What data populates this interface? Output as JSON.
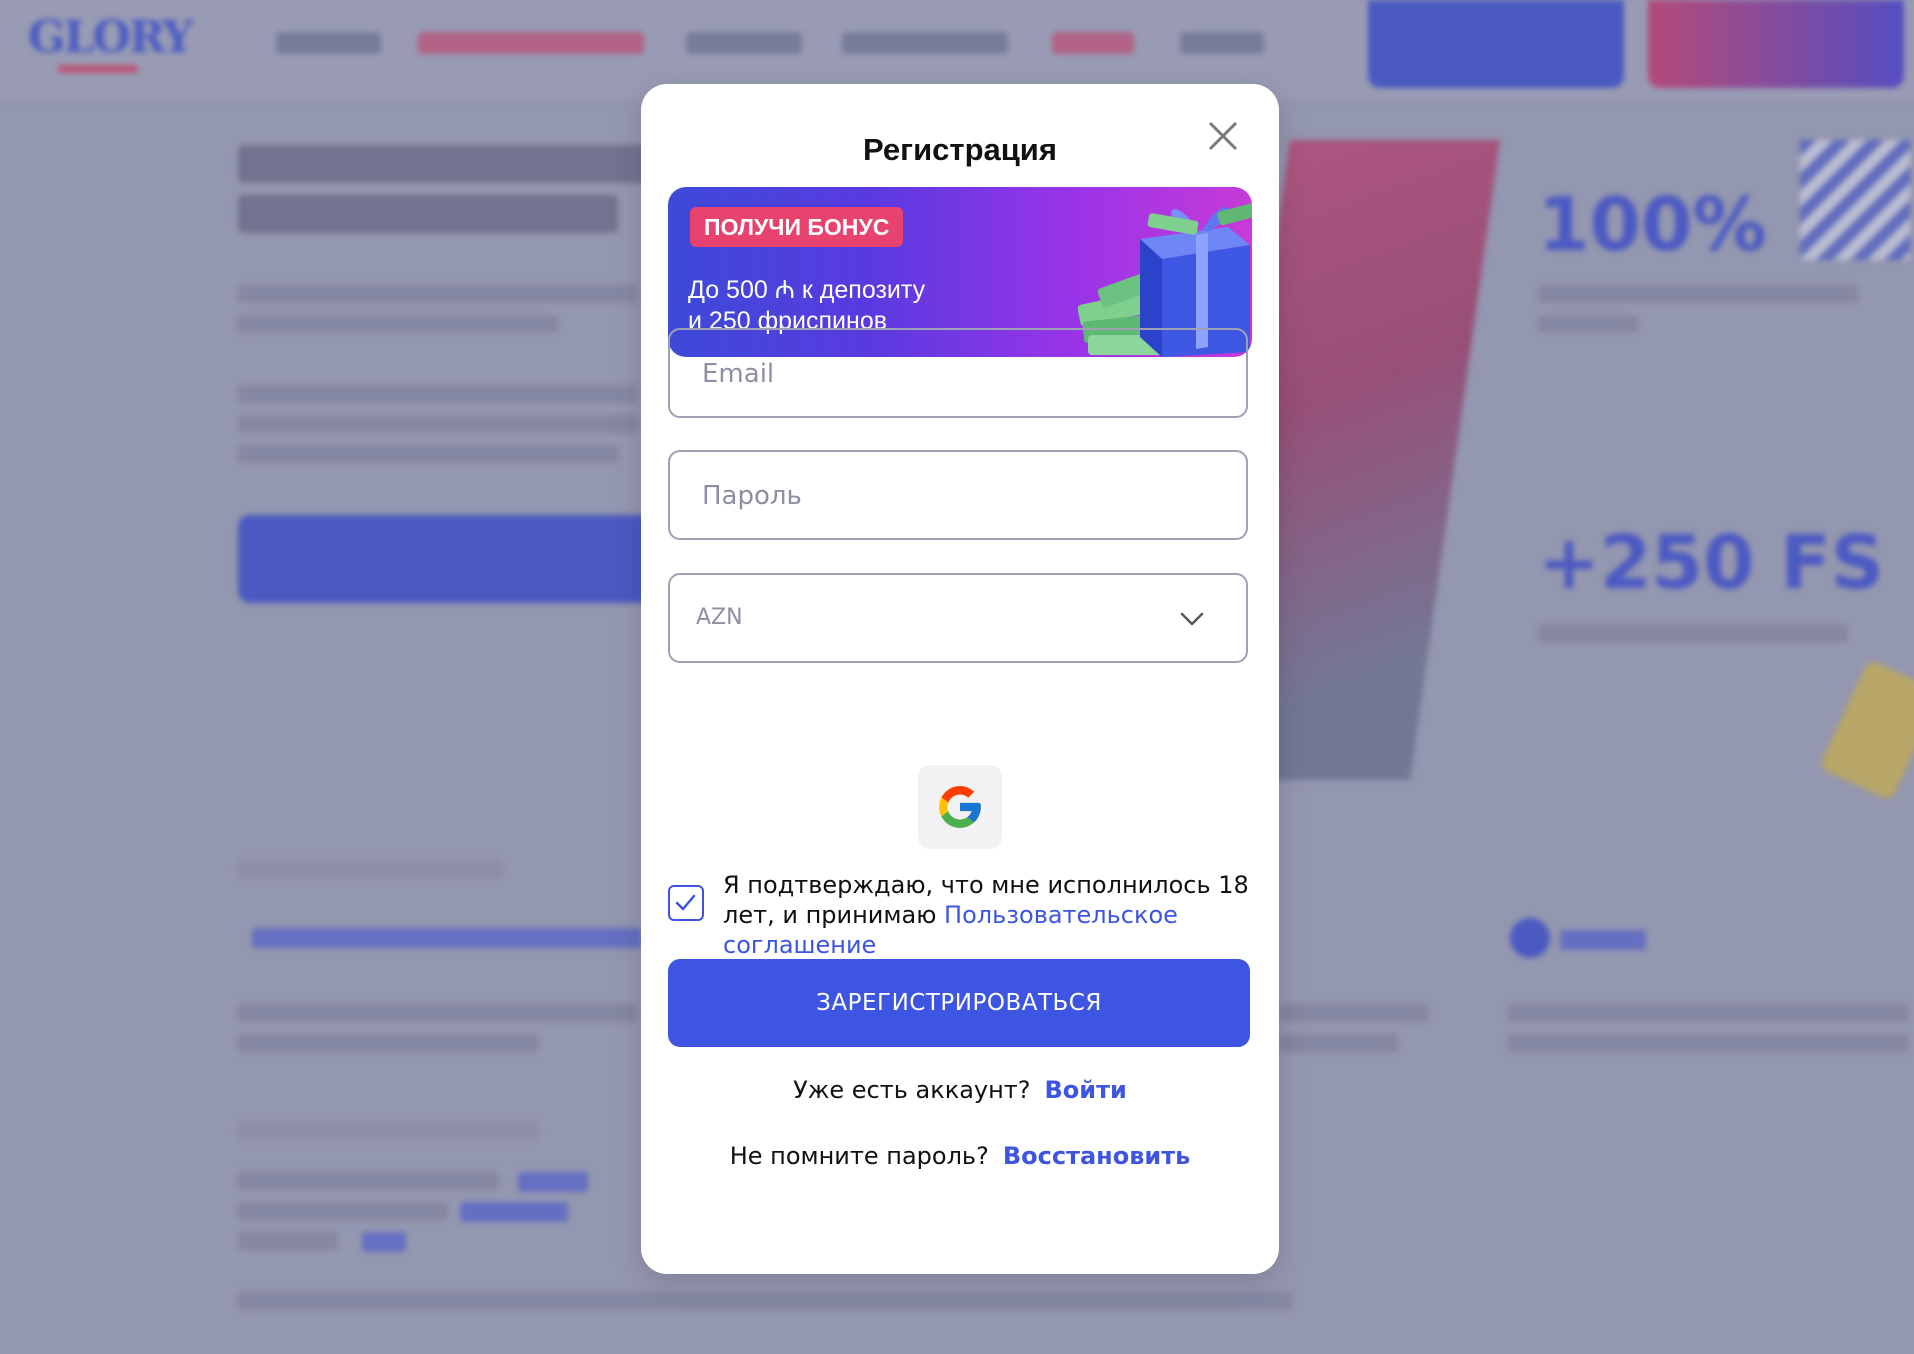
{
  "modal": {
    "title": "Регистрация",
    "banner": {
      "badge": "ПОЛУЧИ БОНУС",
      "line1": "До 500 ₼ к депозиту",
      "line2": "и 250 фриспинов"
    },
    "email": {
      "placeholder": "Email",
      "value": ""
    },
    "password": {
      "placeholder": "Пароль",
      "value": ""
    },
    "currency": {
      "selected": "AZN"
    },
    "consent": {
      "text": "Я подтверждаю, что мне исполнилось 18 лет, и принимаю",
      "link": "Пользовательское соглашение",
      "checked": true
    },
    "submit_label": "ЗАРЕГИСТРИРОВАТЬСЯ",
    "have_account": {
      "text": "Уже есть аккаунт?",
      "link": "Войти"
    },
    "forgot": {
      "text": "Не помните пароль?",
      "link": "Восстановить"
    }
  },
  "colors": {
    "accent": "#3d55e0",
    "badge": "#e8436e",
    "overlay": "#9ea0b8"
  },
  "icons": {
    "close": "close-icon",
    "chevron": "chevron-down-icon",
    "google": "google-icon",
    "check": "check-icon"
  },
  "background": {
    "big_stat_1": "100%",
    "big_stat_2": "+250 FS"
  }
}
